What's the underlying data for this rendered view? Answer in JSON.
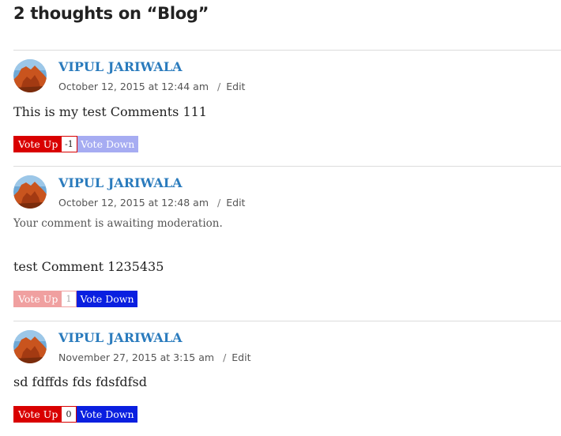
{
  "comments_section": {
    "title": "2 thoughts on “Blog”"
  },
  "colors": {
    "author_link": "#2a7bbd",
    "vote_up": "#d90000",
    "vote_up_disabled": "#f0a0a0",
    "vote_down": "#0a1fe0",
    "vote_down_disabled": "#a6acf2"
  },
  "comments": [
    {
      "author": "VIPUL JARIWALA",
      "date": "October 12, 2015 at 12:44 am",
      "separator": "/",
      "edit_label": "Edit",
      "moderation_note": "",
      "text": "This is my test Comments 111",
      "vote_up_label": "Vote Up",
      "vote_count": "-1",
      "vote_down_label": "Vote Down",
      "avatar_icon": "user-avatar-icon"
    },
    {
      "author": "VIPUL JARIWALA",
      "date": "October 12, 2015 at 12:48 am",
      "separator": "/",
      "edit_label": "Edit",
      "moderation_note": "Your comment is awaiting moderation.",
      "text": "test Comment 1235435",
      "vote_up_label": "Vote Up",
      "vote_count": "1",
      "vote_down_label": "Vote Down",
      "avatar_icon": "user-avatar-icon"
    },
    {
      "author": "VIPUL JARIWALA",
      "date": "November 27, 2015 at 3:15 am",
      "separator": "/",
      "edit_label": "Edit",
      "moderation_note": "",
      "text": "sd fdffds fds fdsfdfsd",
      "vote_up_label": "Vote Up",
      "vote_count": "0",
      "vote_down_label": "Vote Down",
      "avatar_icon": "user-avatar-icon"
    }
  ]
}
